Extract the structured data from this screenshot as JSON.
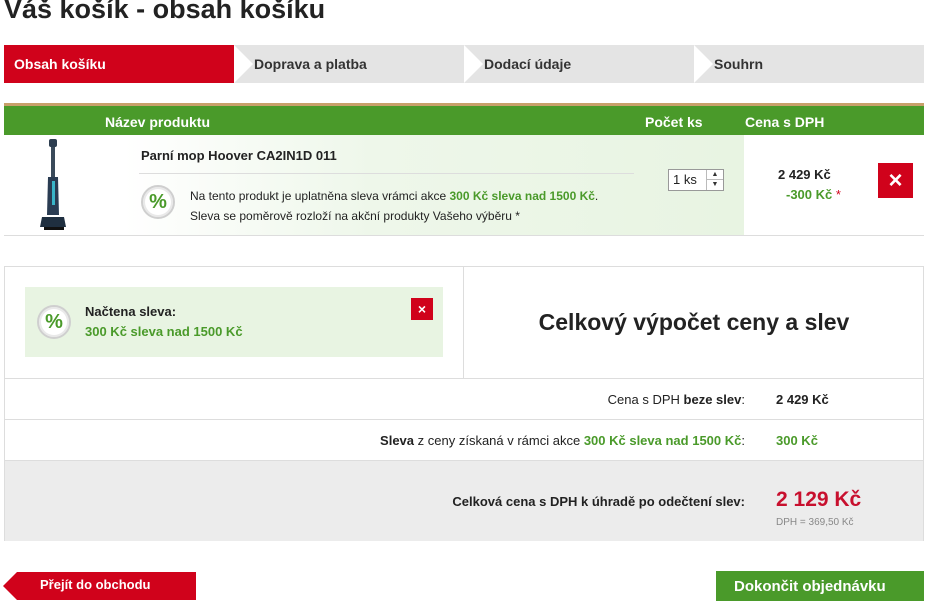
{
  "page": {
    "title": "Váš košík - obsah košíku"
  },
  "steps": [
    {
      "label": "Obsah košíku"
    },
    {
      "label": "Doprava a platba"
    },
    {
      "label": "Dodací údaje"
    },
    {
      "label": "Souhrn"
    }
  ],
  "table": {
    "headers": {
      "name": "Název produktu",
      "qty": "Počet ks",
      "price": "Cena s DPH"
    }
  },
  "product": {
    "name": "Parní mop Hoover CA2IN1D 011",
    "discount_icon": "%",
    "discount_text_1": "Na tento produkt je uplatněna sleva vrámci akce ",
    "discount_action": "300 Kč sleva nad 1500 Kč",
    "discount_text_1_end": ".",
    "discount_text_2": "Sleva se poměrově rozloží na akční produkty Vašeho výběru *",
    "quantity": "1 ks",
    "price": "2 429 Kč",
    "price_discount": "-300 Kč",
    "price_discount_star": "*",
    "delete_icon": "×"
  },
  "summary": {
    "loaded_icon": "%",
    "loaded_label": "Načtena sleva:",
    "loaded_value": "300 Kč sleva nad 1500 Kč",
    "loaded_delete": "×",
    "calc_title": "Celkový výpočet ceny a slev",
    "row1_label_a": "Cena s DPH ",
    "row1_label_b": "beze slev",
    "row1_label_c": ":",
    "row1_value": "2 429 Kč",
    "row2_label_a": "Sleva",
    "row2_label_b": " z ceny získaná v rámci akce ",
    "row2_label_c": "300 Kč sleva nad 1500 Kč",
    "row2_label_d": ":",
    "row2_value": "300 Kč",
    "row3_label": "Celková cena s DPH k úhradě po odečtení slev:",
    "row3_value": "2 129 Kč",
    "row3_dph": "DPH = 369,50 Kč"
  },
  "buttons": {
    "back": "Přejít do obchodu",
    "finish": "Dokončit objednávku"
  },
  "colors": {
    "accent_red": "#d0021b",
    "accent_green": "#4a9a2a"
  }
}
